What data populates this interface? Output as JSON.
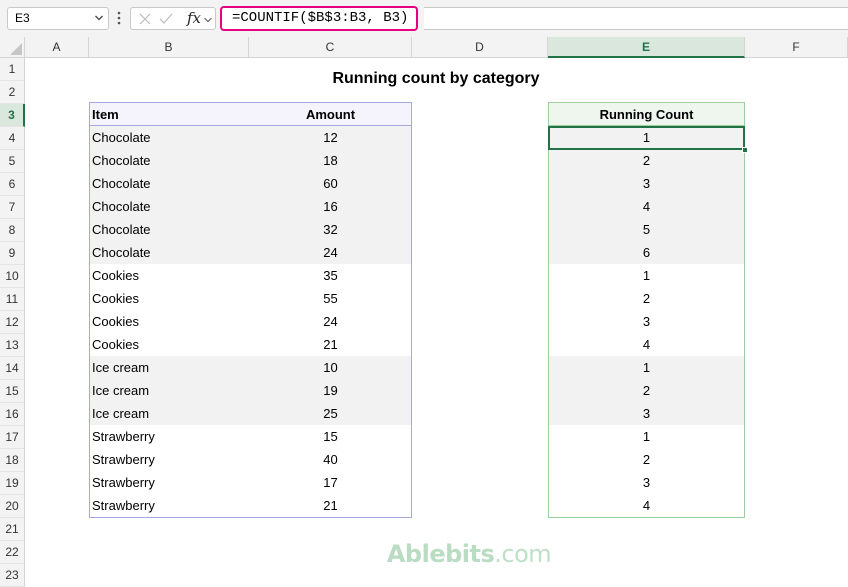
{
  "name_box": "E3",
  "formula": "=COUNTIF($B$3:B3, B3)",
  "fx_label": "fx",
  "columns": [
    "A",
    "B",
    "C",
    "D",
    "E",
    "F"
  ],
  "rows": [
    "1",
    "2",
    "3",
    "4",
    "5",
    "6",
    "7",
    "8",
    "9",
    "10",
    "11",
    "12",
    "13",
    "14",
    "15",
    "16",
    "17",
    "18",
    "19",
    "20",
    "21",
    "22",
    "23"
  ],
  "title": "Running count by category",
  "table": {
    "headers": {
      "item": "Item",
      "amount": "Amount"
    },
    "rows": [
      {
        "item": "Chocolate",
        "amount": "12"
      },
      {
        "item": "Chocolate",
        "amount": "18"
      },
      {
        "item": "Chocolate",
        "amount": "60"
      },
      {
        "item": "Chocolate",
        "amount": "16"
      },
      {
        "item": "Chocolate",
        "amount": "32"
      },
      {
        "item": "Chocolate",
        "amount": "24"
      },
      {
        "item": "Cookies",
        "amount": "35"
      },
      {
        "item": "Cookies",
        "amount": "55"
      },
      {
        "item": "Cookies",
        "amount": "24"
      },
      {
        "item": "Cookies",
        "amount": "21"
      },
      {
        "item": "Ice cream",
        "amount": "10"
      },
      {
        "item": "Ice cream",
        "amount": "19"
      },
      {
        "item": "Ice cream",
        "amount": "25"
      },
      {
        "item": "Strawberry",
        "amount": "15"
      },
      {
        "item": "Strawberry",
        "amount": "40"
      },
      {
        "item": "Strawberry",
        "amount": "17"
      },
      {
        "item": "Strawberry",
        "amount": "21"
      }
    ]
  },
  "running_count": {
    "header": "Running Count",
    "values": [
      "1",
      "2",
      "3",
      "4",
      "5",
      "6",
      "1",
      "2",
      "3",
      "4",
      "1",
      "2",
      "3",
      "1",
      "2",
      "3",
      "4"
    ]
  },
  "watermark": {
    "bold": "Ablebits",
    "rest": ".com"
  },
  "colors": {
    "selection": "#217346",
    "formula_highlight": "#e6007e"
  }
}
